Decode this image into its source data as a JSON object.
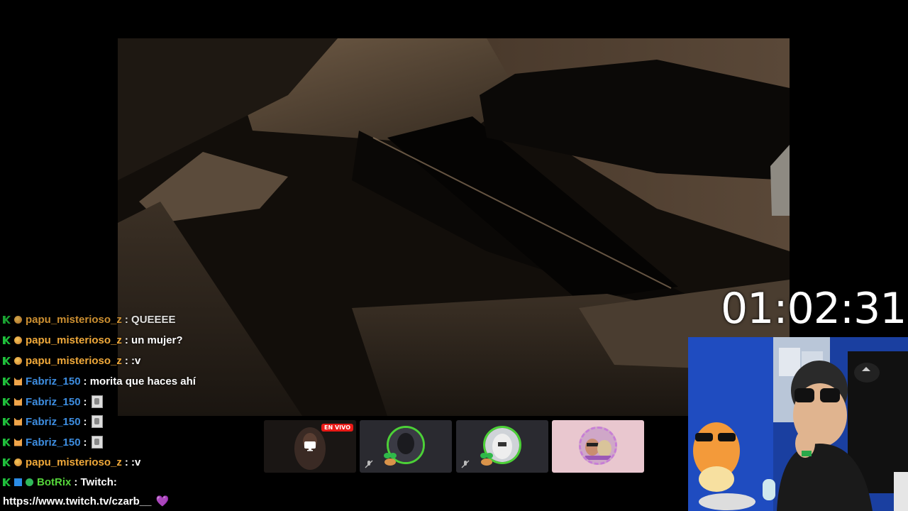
{
  "stream": {
    "timer": "01:02:31",
    "live_label": "EN VIVO"
  },
  "chat": {
    "messages": [
      {
        "user": "papu_misterioso_z",
        "text": ": QUEEEE",
        "user_color": "orange",
        "badges": [
          "k-icon",
          "ball-icon"
        ]
      },
      {
        "user": "papu_misterioso_z",
        "text": ": un mujer?",
        "user_color": "orange",
        "badges": [
          "k-icon",
          "ball-icon"
        ]
      },
      {
        "user": "papu_misterioso_z",
        "text": ": :v",
        "user_color": "orange",
        "badges": [
          "k-icon",
          "ball-icon"
        ]
      },
      {
        "user": "Fabriz_150",
        "text": ": morita que haces ahí",
        "user_color": "blue",
        "badges": [
          "k-icon",
          "cat-icon"
        ]
      },
      {
        "user": "Fabriz_150",
        "text": ":",
        "user_color": "blue",
        "badges": [
          "k-icon",
          "cat-icon"
        ],
        "emote": true
      },
      {
        "user": "Fabriz_150",
        "text": ":",
        "user_color": "blue",
        "badges": [
          "k-icon",
          "cat-icon"
        ],
        "emote": true
      },
      {
        "user": "Fabriz_150",
        "text": ":",
        "user_color": "blue",
        "badges": [
          "k-icon",
          "cat-icon"
        ],
        "emote": true
      },
      {
        "user": "papu_misterioso_z",
        "text": ": :v",
        "user_color": "orange",
        "badges": [
          "k-icon",
          "ball-icon"
        ]
      },
      {
        "user": "BotRix",
        "text": ": Twitch:",
        "user_color": "green",
        "badges": [
          "k-icon",
          "bot-icon",
          "verified-icon"
        ]
      }
    ],
    "link_line": "https://www.twitch.tv/czarb__",
    "link_heart": "💜"
  },
  "colors": {
    "orange": "#f0a93a",
    "blue": "#3d8de0",
    "green": "#55d63a",
    "live_red": "#e91916",
    "ring_green": "#4cd137"
  }
}
